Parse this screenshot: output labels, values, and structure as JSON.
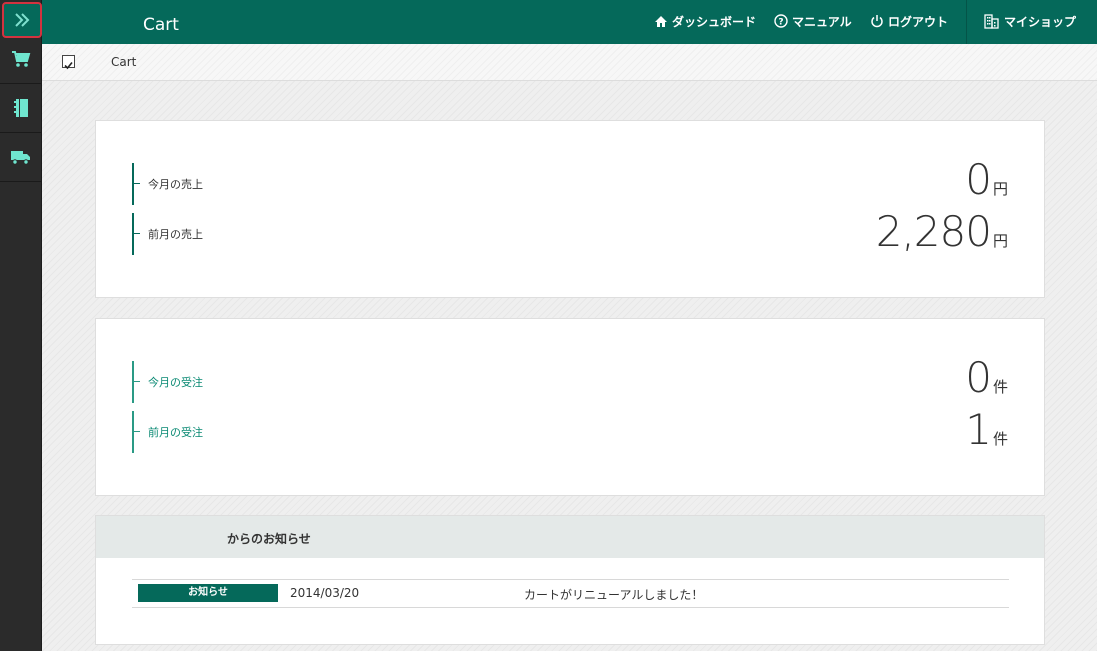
{
  "header": {
    "title": "Cart",
    "nav": [
      {
        "label": "ダッシュボード",
        "icon": "home-icon"
      },
      {
        "label": "マニュアル",
        "icon": "help-circle-icon"
      },
      {
        "label": "ログアウト",
        "icon": "power-icon"
      },
      {
        "label": "マイショップ",
        "icon": "building-icon"
      }
    ]
  },
  "sidebar": {
    "items": [
      {
        "icon": "cart-icon"
      },
      {
        "icon": "notebook-icon"
      },
      {
        "icon": "truck-icon"
      }
    ]
  },
  "breadcrumb": {
    "label": "Cart"
  },
  "sales": {
    "this_month": {
      "label": "今月の売上",
      "value": "0",
      "unit": "円"
    },
    "last_month": {
      "label": "前月の売上",
      "value": "2,280",
      "unit": "円"
    }
  },
  "orders": {
    "this_month": {
      "label": "今月の受注",
      "value": "0",
      "unit": "件"
    },
    "last_month": {
      "label": "前月の受注",
      "value": "1",
      "unit": "件"
    }
  },
  "news": {
    "title": "からのお知らせ",
    "items": [
      {
        "badge": "お知らせ",
        "date": "2014/03/20",
        "text": "カートがリニューアルしました！"
      }
    ]
  },
  "colors": {
    "accent": "#05695a",
    "sidebar": "#2b2b2b",
    "highlight": "#d4323f"
  }
}
